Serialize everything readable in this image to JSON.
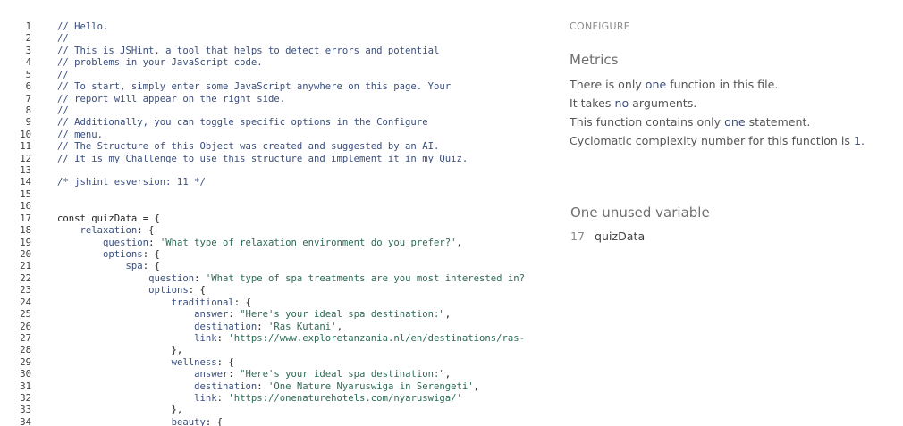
{
  "editor": {
    "lines": [
      {
        "n": "1",
        "tokens": [
          [
            "comment",
            "// Hello."
          ]
        ]
      },
      {
        "n": "2",
        "tokens": [
          [
            "comment",
            "//"
          ]
        ]
      },
      {
        "n": "3",
        "tokens": [
          [
            "comment",
            "// This is JSHint, a tool that helps to detect errors and potential"
          ]
        ]
      },
      {
        "n": "4",
        "tokens": [
          [
            "comment",
            "// problems in your JavaScript code."
          ]
        ]
      },
      {
        "n": "5",
        "tokens": [
          [
            "comment",
            "//"
          ]
        ]
      },
      {
        "n": "6",
        "tokens": [
          [
            "comment",
            "// To start, simply enter some JavaScript anywhere on this page. Your"
          ]
        ]
      },
      {
        "n": "7",
        "tokens": [
          [
            "comment",
            "// report will appear on the right side."
          ]
        ]
      },
      {
        "n": "8",
        "tokens": [
          [
            "comment",
            "//"
          ]
        ]
      },
      {
        "n": "9",
        "tokens": [
          [
            "comment",
            "// Additionally, you can toggle specific options in the Configure"
          ]
        ]
      },
      {
        "n": "10",
        "tokens": [
          [
            "comment",
            "// menu."
          ]
        ]
      },
      {
        "n": "11",
        "tokens": [
          [
            "comment",
            "// The Structure of this Object was created and suggested by an AI."
          ]
        ]
      },
      {
        "n": "12",
        "tokens": [
          [
            "comment",
            "// It is my Challenge to use this structure and implement it in my Quiz."
          ]
        ]
      },
      {
        "n": "13",
        "tokens": []
      },
      {
        "n": "14",
        "tokens": [
          [
            "comment",
            "/* jshint esversion: 11 */"
          ]
        ]
      },
      {
        "n": "15",
        "tokens": []
      },
      {
        "n": "16",
        "tokens": []
      },
      {
        "n": "17",
        "tokens": [
          [
            "keyword",
            "const"
          ],
          [
            "punct",
            " "
          ],
          [
            "def",
            "quizData"
          ],
          [
            "punct",
            " = {"
          ]
        ]
      },
      {
        "n": "18",
        "tokens": [
          [
            "punct",
            "    "
          ],
          [
            "prop",
            "relaxation"
          ],
          [
            "punct",
            ": {"
          ]
        ]
      },
      {
        "n": "19",
        "tokens": [
          [
            "punct",
            "        "
          ],
          [
            "prop",
            "question"
          ],
          [
            "punct",
            ": "
          ],
          [
            "string",
            "'What type of relaxation environment do you prefer?'"
          ],
          [
            "punct",
            ","
          ]
        ]
      },
      {
        "n": "20",
        "tokens": [
          [
            "punct",
            "        "
          ],
          [
            "prop",
            "options"
          ],
          [
            "punct",
            ": {"
          ]
        ]
      },
      {
        "n": "21",
        "tokens": [
          [
            "punct",
            "            "
          ],
          [
            "prop",
            "spa"
          ],
          [
            "punct",
            ": {"
          ]
        ]
      },
      {
        "n": "22",
        "tokens": [
          [
            "punct",
            "                "
          ],
          [
            "prop",
            "question"
          ],
          [
            "punct",
            ": "
          ],
          [
            "string",
            "'What type of spa treatments are you most interested in?"
          ]
        ]
      },
      {
        "n": "23",
        "tokens": [
          [
            "punct",
            "                "
          ],
          [
            "prop",
            "options"
          ],
          [
            "punct",
            ": {"
          ]
        ]
      },
      {
        "n": "24",
        "tokens": [
          [
            "punct",
            "                    "
          ],
          [
            "prop",
            "traditional"
          ],
          [
            "punct",
            ": {"
          ]
        ]
      },
      {
        "n": "25",
        "tokens": [
          [
            "punct",
            "                        "
          ],
          [
            "prop",
            "answer"
          ],
          [
            "punct",
            ": "
          ],
          [
            "string",
            "\"Here's your ideal spa destination:\""
          ],
          [
            "punct",
            ","
          ]
        ]
      },
      {
        "n": "26",
        "tokens": [
          [
            "punct",
            "                        "
          ],
          [
            "prop",
            "destination"
          ],
          [
            "punct",
            ": "
          ],
          [
            "string",
            "'Ras Kutani'"
          ],
          [
            "punct",
            ","
          ]
        ]
      },
      {
        "n": "27",
        "tokens": [
          [
            "punct",
            "                        "
          ],
          [
            "prop",
            "link"
          ],
          [
            "punct",
            ": "
          ],
          [
            "string",
            "'https://www.exploretanzania.nl/en/destinations/ras-"
          ]
        ]
      },
      {
        "n": "28",
        "tokens": [
          [
            "punct",
            "                    },"
          ]
        ]
      },
      {
        "n": "29",
        "tokens": [
          [
            "punct",
            "                    "
          ],
          [
            "prop",
            "wellness"
          ],
          [
            "punct",
            ": {"
          ]
        ]
      },
      {
        "n": "30",
        "tokens": [
          [
            "punct",
            "                        "
          ],
          [
            "prop",
            "answer"
          ],
          [
            "punct",
            ": "
          ],
          [
            "string",
            "\"Here's your ideal spa destination:\""
          ],
          [
            "punct",
            ","
          ]
        ]
      },
      {
        "n": "31",
        "tokens": [
          [
            "punct",
            "                        "
          ],
          [
            "prop",
            "destination"
          ],
          [
            "punct",
            ": "
          ],
          [
            "string",
            "'One Nature Nyaruswiga in Serengeti'"
          ],
          [
            "punct",
            ","
          ]
        ]
      },
      {
        "n": "32",
        "tokens": [
          [
            "punct",
            "                        "
          ],
          [
            "prop",
            "link"
          ],
          [
            "punct",
            ": "
          ],
          [
            "string",
            "'https://onenaturehotels.com/nyaruswiga/'"
          ]
        ]
      },
      {
        "n": "33",
        "tokens": [
          [
            "punct",
            "                    },"
          ]
        ]
      },
      {
        "n": "34",
        "tokens": [
          [
            "punct",
            "                    "
          ],
          [
            "prop",
            "beauty"
          ],
          [
            "punct",
            ": {"
          ]
        ]
      }
    ]
  },
  "panel": {
    "configure_label": "CONFIGURE",
    "metrics_title": "Metrics",
    "metrics": {
      "line1_pre": "There is only ",
      "line1_hl": "one",
      "line1_post": " function in this file.",
      "line2_pre": "It takes ",
      "line2_hl": "no",
      "line2_post": " arguments.",
      "line3_pre": "This function contains only ",
      "line3_hl": "one",
      "line3_post": " statement.",
      "line4_pre": "Cyclomatic complexity number for this function is ",
      "line4_hl": "1",
      "line4_post": "."
    },
    "unused_title": "One unused variable",
    "unused_line": "17",
    "unused_name": "quizData"
  },
  "colors": {
    "comment": "#3a4e7e",
    "string": "#2b6a55",
    "highlight": "#3a4e7e"
  }
}
